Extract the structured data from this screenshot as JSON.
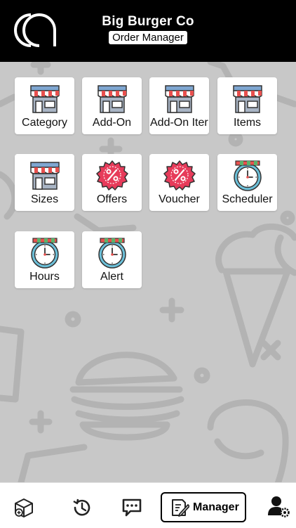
{
  "header": {
    "title": "Big Burger Co",
    "subtitle": "Order Manager",
    "logo_icon": "brand-logo-icon"
  },
  "menu": [
    {
      "label": "Category",
      "icon": "store-icon"
    },
    {
      "label": "Add-On",
      "icon": "store-icon"
    },
    {
      "label": "Add-On Iter",
      "icon": "store-icon"
    },
    {
      "label": "Items",
      "icon": "store-icon"
    },
    {
      "label": "Sizes",
      "icon": "store-icon"
    },
    {
      "label": "Offers",
      "icon": "percent-badge-icon"
    },
    {
      "label": "Voucher",
      "icon": "percent-badge-icon"
    },
    {
      "label": "Scheduler",
      "icon": "clock-icon"
    },
    {
      "label": "Hours",
      "icon": "clock-icon"
    },
    {
      "label": "Alert",
      "icon": "clock-icon"
    }
  ],
  "tabbar": {
    "orders_icon": "package-icon",
    "history_icon": "history-icon",
    "messages_icon": "chat-icon",
    "manager_label": "Manager",
    "manager_icon": "edit-note-icon",
    "account_icon": "user-settings-icon"
  },
  "colors": {
    "header_bg": "#000000",
    "page_bg": "#c8c8c8",
    "tile_bg": "#ffffff",
    "awning_red": "#e8504e",
    "roof_blue": "#7fa6d1",
    "badge_red": "#e73b5a",
    "clock_ring": "#6cc0d9"
  }
}
